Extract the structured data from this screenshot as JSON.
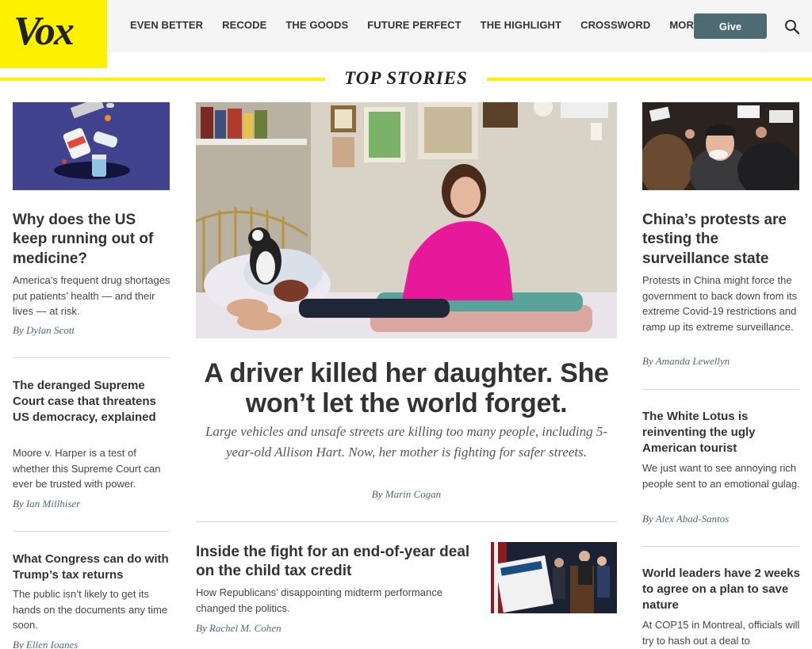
{
  "brand": {
    "logo": "Vox",
    "accent": "#fff200",
    "give_color": "#4e6b73"
  },
  "nav": {
    "items": [
      "EVEN BETTER",
      "RECODE",
      "THE GOODS",
      "FUTURE PERFECT",
      "THE HIGHLIGHT",
      "CROSSWORD"
    ],
    "more": "MORE",
    "give": "Give",
    "search_icon": "search-icon"
  },
  "section_title": "TOP STORIES",
  "left": [
    {
      "headline": "Why does the US keep running out of medicine?",
      "dek": "America’s frequent drug shortages put patients’ health — and their lives — at risk.",
      "by": "By",
      "author": "Dylan Scott"
    },
    {
      "headline": "The deranged Supreme Court case that threatens US democracy, explained",
      "dek": "Moore v. Harper is a test of whether this Supreme Court can ever be trusted with power.",
      "by": "By",
      "author": "Ian Millhiser"
    },
    {
      "headline": "What Congress can do with Trump’s tax returns",
      "dek": "The public isn’t likely to get its hands on the documents any time soon.",
      "by": "By",
      "author": "Ellen Ioanes"
    }
  ],
  "center": {
    "headline": "A driver killed her daughter. She won’t let the world forget.",
    "dek": "Large vehicles and unsafe streets are killing too many people, including 5-year-old Allison Hart. Now, her mother is fighting for safer streets.",
    "by": "By",
    "author": "Marin Cogan",
    "secondary": {
      "headline": "Inside the fight for an end-of-year deal on the child tax credit",
      "dek": "How Republicans’ disappointing midterm performance changed the politics.",
      "by": "By",
      "author": "Rachel M. Cohen"
    }
  },
  "right": [
    {
      "headline": "China’s protests are testing the surveillance state",
      "dek": "Protests in China might force the government to back down from its extreme Covid-19 restrictions and ramp up its extreme surveillance.",
      "by": "By",
      "author": "Amanda Lewellyn"
    },
    {
      "headline": "The White Lotus is reinventing the ugly American tourist",
      "dek": "We just want to see annoying rich people sent to an emotional gulag.",
      "by": "By",
      "author": "Alex Abad-Santos"
    },
    {
      "headline": "World leaders have 2 weeks to agree on a plan to save nature",
      "dek": "At COP15 in Montreal, officials will try to hash out a deal to"
    }
  ]
}
